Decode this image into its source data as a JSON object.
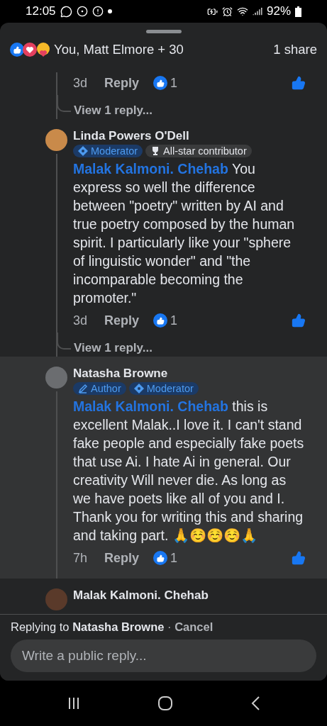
{
  "status_bar": {
    "time": "12:05",
    "battery": "92%"
  },
  "reactions": {
    "summary": "You, Matt Elmore + 30",
    "shares": "1 share"
  },
  "comments": [
    {
      "time": "3d",
      "reply": "Reply",
      "likes": "1",
      "liked": true,
      "view_replies": "View 1 reply...",
      "highlighted": false
    },
    {
      "author": "Linda Powers O'Dell",
      "badges": [
        {
          "kind": "moderator",
          "label": "Moderator"
        },
        {
          "kind": "allstar",
          "label": "All-star contributor"
        }
      ],
      "mention": "Malak Kalmoni. Chehab",
      "text": " You express so well the difference between \"poetry\" written by AI and true poetry composed by the human spirit. I particularly like your \"sphere of linguistic wonder\" and \"the incomparable becoming the promoter.\"",
      "time": "3d",
      "reply": "Reply",
      "likes": "1",
      "liked": true,
      "view_replies": "View 1 reply...",
      "highlighted": false
    },
    {
      "author": "Natasha Browne",
      "badges": [
        {
          "kind": "author",
          "label": "Author"
        },
        {
          "kind": "moderator",
          "label": "Moderator"
        }
      ],
      "mention": "Malak Kalmoni. Chehab",
      "text": " this is excellent Malak..I love it. I can't stand fake people and especially fake poets that use Ai. I hate Ai in general. Our creativity Will never die. As long as we have poets like all of you and I. Thank you for writing this and sharing and taking part. 🙏☺️☺️☺️🙏",
      "time": "7h",
      "reply": "Reply",
      "likes": "1",
      "liked": true,
      "highlighted": true
    },
    {
      "author": "Malak Kalmoni. Chehab",
      "highlighted": false
    }
  ],
  "reply_bar": {
    "prefix": "Replying to",
    "target": "Natasha Browne",
    "separator": "·",
    "cancel": "Cancel",
    "placeholder": "Write a public reply..."
  }
}
